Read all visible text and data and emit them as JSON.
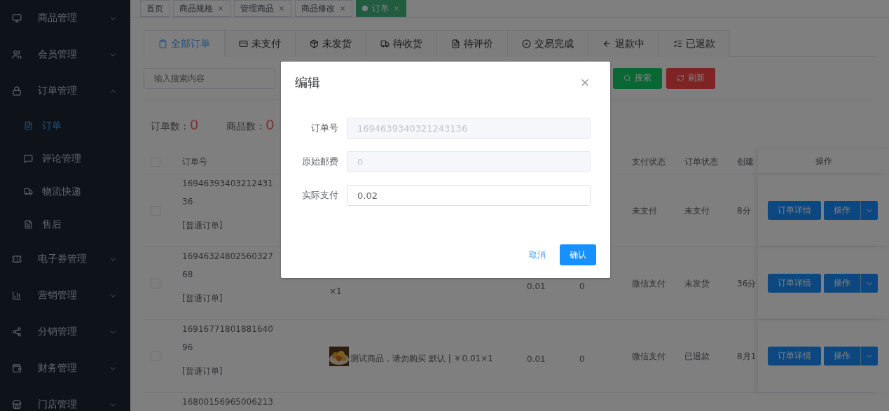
{
  "sidebar": {
    "items": [
      {
        "label": "商品管理",
        "expanded": false
      },
      {
        "label": "会员管理",
        "expanded": false
      },
      {
        "label": "订单管理",
        "expanded": true,
        "children": [
          {
            "label": "订单",
            "selected": true
          },
          {
            "label": "评论管理",
            "selected": false
          },
          {
            "label": "物流快递",
            "selected": false
          },
          {
            "label": "售后",
            "selected": false
          }
        ]
      },
      {
        "label": "电子券管理",
        "expanded": false
      },
      {
        "label": "营销管理",
        "expanded": false
      },
      {
        "label": "分销管理",
        "expanded": false
      },
      {
        "label": "财务管理",
        "expanded": false
      },
      {
        "label": "门店管理",
        "expanded": false
      }
    ]
  },
  "tags": [
    {
      "label": "首页",
      "closable": false,
      "selected": false
    },
    {
      "label": "商品规格",
      "closable": true,
      "selected": false
    },
    {
      "label": "管理商品",
      "closable": true,
      "selected": false
    },
    {
      "label": "商品修改",
      "closable": true,
      "selected": false
    },
    {
      "label": "订单",
      "closable": true,
      "selected": true
    }
  ],
  "order_tabs": [
    {
      "label": "全部订单",
      "selected": true
    },
    {
      "label": "未支付",
      "selected": false
    },
    {
      "label": "未发货",
      "selected": false
    },
    {
      "label": "待收货",
      "selected": false
    },
    {
      "label": "待评价",
      "selected": false
    },
    {
      "label": "交易完成",
      "selected": false
    },
    {
      "label": "退款中",
      "selected": false
    },
    {
      "label": "已退款",
      "selected": false
    }
  ],
  "search": {
    "placeholder": "输入搜索内容"
  },
  "toolbar_buttons": [
    {
      "label": "搜索",
      "kind": "search"
    },
    {
      "label": "刷新",
      "kind": "refresh"
    }
  ],
  "counts": [
    {
      "label": "订单数 : ",
      "value": "0"
    },
    {
      "label": "商品数 : ",
      "value": "0"
    }
  ],
  "table": {
    "header_checked": false,
    "columns": [
      {
        "label": "订单号"
      },
      {
        "label": "支付状态"
      },
      {
        "label": "订单状态"
      },
      {
        "label": "创建"
      },
      {
        "label": "操作"
      }
    ],
    "rows": [
      {
        "checked": false,
        "order_no": "1694639340321243136",
        "type": "[普通订单]",
        "pay_status": "未支付",
        "order_status": "未支付",
        "created": "8分",
        "actions": [
          "订单详情",
          "操作"
        ]
      },
      {
        "checked": false,
        "order_no": "1694632480256032768",
        "type": "[普通订单]",
        "goods": "×1",
        "price": "0.01",
        "freight": "0",
        "pay_status": "微信支付",
        "order_status": "未发货",
        "created": "36分",
        "actions": [
          "订单详情",
          "操作"
        ]
      },
      {
        "checked": false,
        "order_no": "1691677180188164096",
        "type": "[普通订单]",
        "goods": "测试商品，请勿购买 默认 | ￥0.01×1",
        "goods_picture": {
          "kind": "picture"
        },
        "price": "0.01",
        "freight": "0",
        "pay_status": "微信支付",
        "order_status": "已退款",
        "created": "8月1",
        "actions": [
          "订单详情",
          "操作"
        ]
      },
      {
        "order_no": "16800156965006213"
      }
    ]
  },
  "dialog": {
    "title": "编辑",
    "fields": [
      {
        "label": "订单号",
        "value": "1694639340321243136",
        "disabled": true
      },
      {
        "label": "原始邮费",
        "value": "0",
        "disabled": true
      },
      {
        "label": "实际支付",
        "value": "0.02",
        "disabled": false
      }
    ],
    "cancel": "取消",
    "confirm": "确认"
  }
}
